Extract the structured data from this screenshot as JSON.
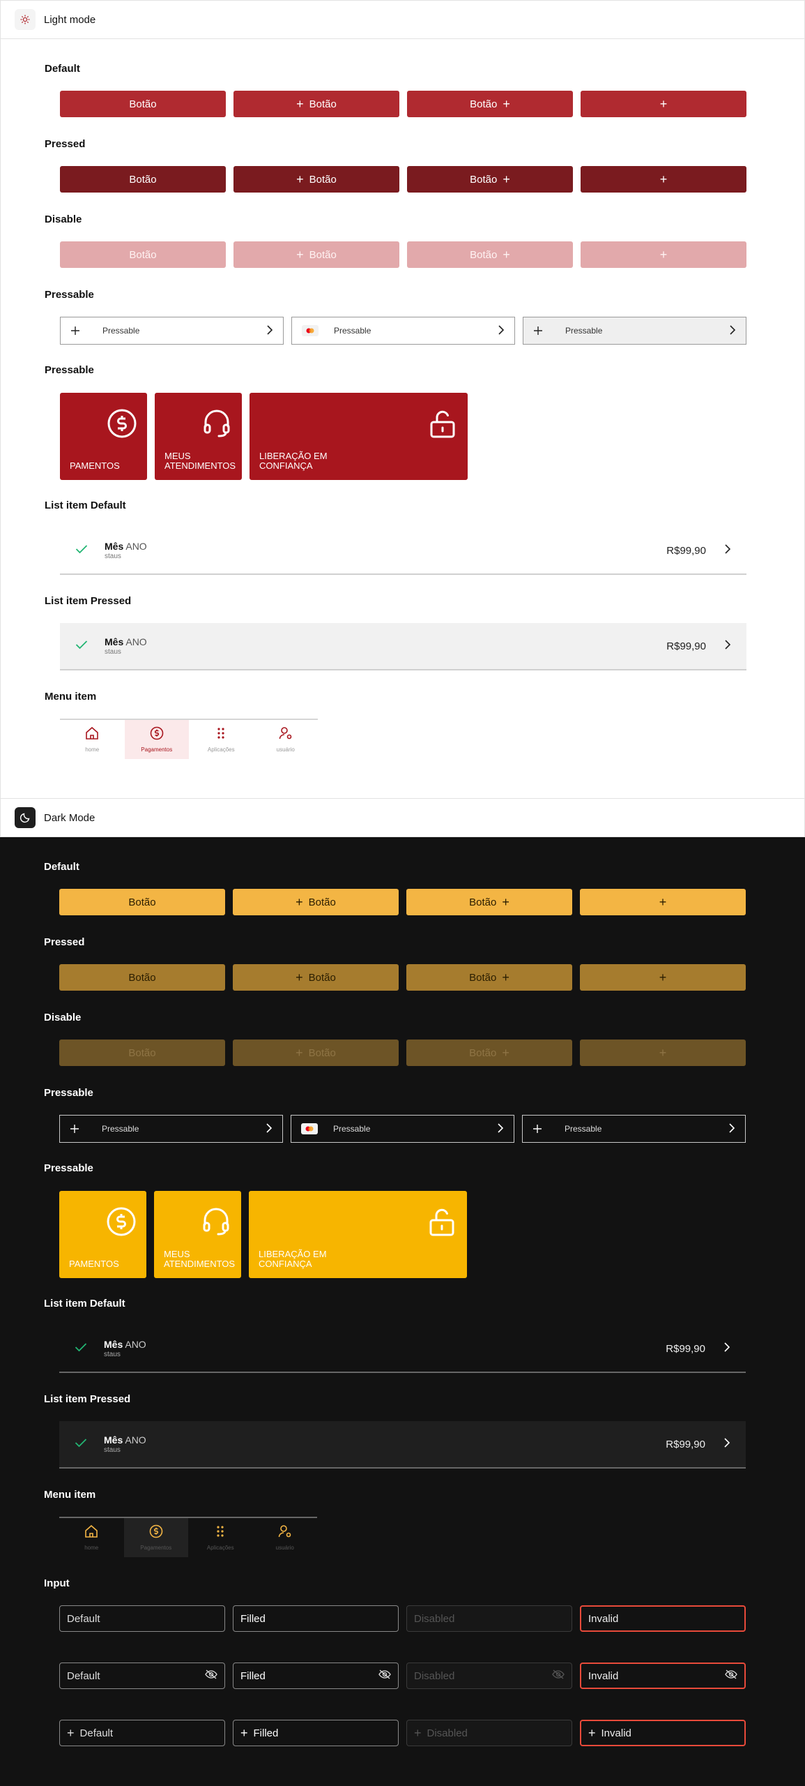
{
  "light": {
    "header_title": "Light mode",
    "header_icon": "sun-icon",
    "sections": {
      "default": "Default",
      "pressed": "Pressed",
      "disable": "Disable",
      "pressable_list": "Pressable",
      "pressable_tiles": "Pressable",
      "list_default": "List item Default",
      "list_pressed": "List item Pressed",
      "menu": "Menu item"
    }
  },
  "dark": {
    "header_title": "Dark Mode",
    "header_icon": "moon-icon",
    "sections": {
      "default": "Default",
      "pressed": "Pressed",
      "disable": "Disable",
      "pressable_list": "Pressable",
      "pressable_tiles": "Pressable",
      "list_default": "List item Default",
      "list_pressed": "List item Pressed",
      "menu": "Menu item",
      "input": "Input"
    }
  },
  "buttons": {
    "label": "Botão",
    "plus": "+"
  },
  "pressable": {
    "label": "Pressable"
  },
  "tiles": {
    "pagamentos": "PAMENTOS",
    "atendimentos": "MEUS ATENDIMENTOS",
    "liberacao": "LIBERAÇÃO EM CONFIANÇA"
  },
  "list_item": {
    "month": "Mês",
    "year": "ANO",
    "status": "staus",
    "price": "R$99,90"
  },
  "menu": {
    "home": "home",
    "pagamentos": "Pagamentos",
    "aplicacoes": "Aplicações",
    "usuario": "usuário"
  },
  "inputs": {
    "default": "Default",
    "filled": "Filled",
    "disabled": "Disabled",
    "invalid": "Invalid"
  },
  "colors": {
    "light_primary": "#b02a30",
    "light_pressed": "#7a1b1f",
    "light_disabled": "#e2a9ab",
    "dark_primary": "#f3b544",
    "dark_pressed": "#a67c2e",
    "dark_disabled": "#6d5426",
    "success": "#22b573",
    "error": "#e84a3a"
  }
}
